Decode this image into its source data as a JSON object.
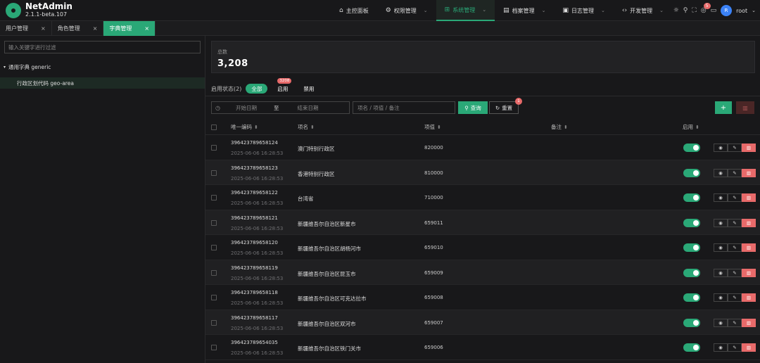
{
  "app": {
    "title": "NetAdmin",
    "version": "2.1.1-beta.107"
  },
  "nav": [
    {
      "label": "主控面板",
      "icon": "home-icon",
      "chevron": false,
      "active": false
    },
    {
      "label": "权限管理",
      "icon": "gear-icon",
      "chevron": true,
      "active": false
    },
    {
      "label": "系统管理",
      "icon": "grid-icon",
      "chevron": true,
      "active": true
    },
    {
      "label": "档案管理",
      "icon": "archive-icon",
      "chevron": true,
      "active": false
    },
    {
      "label": "日志管理",
      "icon": "log-icon",
      "chevron": true,
      "active": false
    },
    {
      "label": "开发管理",
      "icon": "code-icon",
      "chevron": true,
      "active": false
    }
  ],
  "user": {
    "avatar": "R",
    "name": "root",
    "notify_badge": "5"
  },
  "tabs": [
    {
      "label": "用户管理",
      "active": false
    },
    {
      "label": "角色管理",
      "active": false
    },
    {
      "label": "字典管理",
      "active": true
    }
  ],
  "sidebar": {
    "filter_placeholder": "输入关键字进行过滤",
    "tree_root": "通用字典 generic",
    "tree_child": "行政区划代码 geo-area"
  },
  "stat": {
    "label": "总数",
    "value": "3,208"
  },
  "status_filter": {
    "label": "启用状态(2)",
    "options": [
      {
        "label": "全部",
        "active": true,
        "badge": ""
      },
      {
        "label": "启用",
        "active": false,
        "badge": "3208"
      },
      {
        "label": "禁用",
        "active": false,
        "badge": ""
      }
    ]
  },
  "search": {
    "date_start": "开始日期",
    "date_sep": "至",
    "date_end": "结束日期",
    "keyword_placeholder": "项名 / 项值 / 备注",
    "query_label": "查询",
    "reset_label": "重置",
    "reset_badge": "1"
  },
  "table": {
    "columns": {
      "code": "唯一编码",
      "name": "项名",
      "value": "项值",
      "note": "备注",
      "enabled": "启用"
    },
    "rows": [
      {
        "code": "396423789658124",
        "time": "2025-06-06 16:28:53",
        "name": "澳门特别行政区",
        "value": "820000",
        "enabled": true
      },
      {
        "code": "396423789658123",
        "time": "2025-06-06 16:28:53",
        "name": "香港特别行政区",
        "value": "810000",
        "enabled": true
      },
      {
        "code": "396423789658122",
        "time": "2025-06-06 16:28:53",
        "name": "台湾省",
        "value": "710000",
        "enabled": true
      },
      {
        "code": "396423789658121",
        "time": "2025-06-06 16:28:53",
        "name": "新疆维吾尔自治区新星市",
        "value": "659011",
        "enabled": true
      },
      {
        "code": "396423789658120",
        "time": "2025-06-06 16:28:53",
        "name": "新疆维吾尔自治区胡杨河市",
        "value": "659010",
        "enabled": true
      },
      {
        "code": "396423789658119",
        "time": "2025-06-06 16:28:53",
        "name": "新疆维吾尔自治区昆玉市",
        "value": "659009",
        "enabled": true
      },
      {
        "code": "396423789658118",
        "time": "2025-06-06 16:28:53",
        "name": "新疆维吾尔自治区可克达拉市",
        "value": "659008",
        "enabled": true
      },
      {
        "code": "396423789658117",
        "time": "2025-06-06 16:28:53",
        "name": "新疆维吾尔自治区双河市",
        "value": "659007",
        "enabled": true
      },
      {
        "code": "396423789654035",
        "time": "2025-06-06 16:28:53",
        "name": "新疆维吾尔自治区铁门关市",
        "value": "659006",
        "enabled": true
      }
    ]
  },
  "colors": {
    "accent": "#2aa877",
    "danger": "#e86a6a",
    "bg": "#18181a"
  }
}
